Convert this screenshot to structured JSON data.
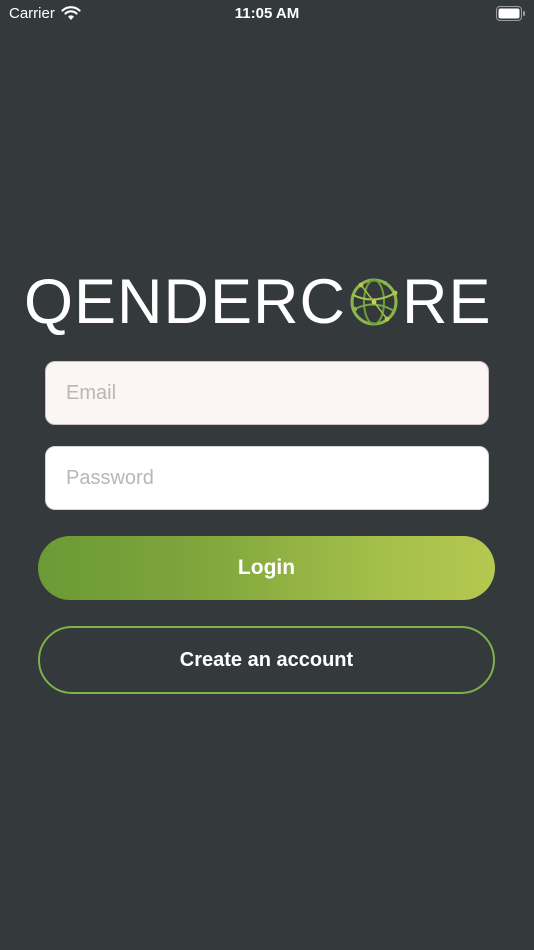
{
  "status_bar": {
    "carrier": "Carrier",
    "time": "11:05 AM",
    "wifi_icon": "wifi-icon",
    "battery_icon": "battery-icon"
  },
  "logo": {
    "text_before": "QENDERC",
    "text_after": "RE",
    "globe_icon": "globe-icon",
    "accent_color": "#8db64a"
  },
  "form": {
    "email_placeholder": "Email",
    "email_value": "",
    "password_placeholder": "Password",
    "password_value": ""
  },
  "buttons": {
    "login_label": "Login",
    "create_account_label": "Create an account"
  },
  "colors": {
    "background": "#343a3c",
    "primary_green": "#6b9a35",
    "secondary_green": "#b5c84f",
    "outline_green": "#7fb04a"
  }
}
